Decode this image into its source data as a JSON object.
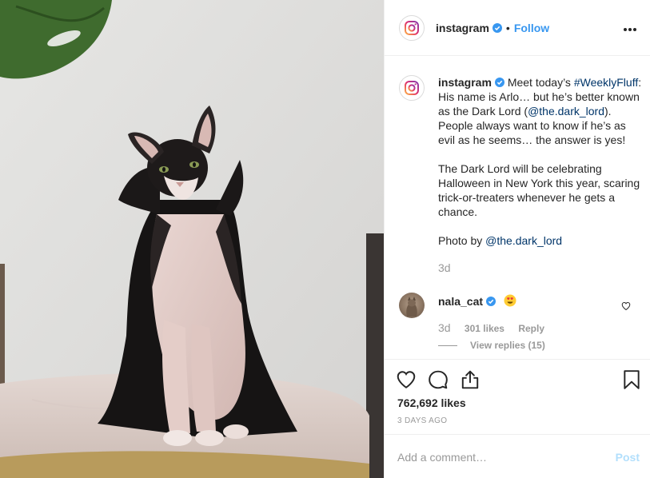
{
  "header": {
    "username": "instagram",
    "separator": "•",
    "follow_label": "Follow"
  },
  "caption": {
    "username": "instagram",
    "text_1": "Meet today’s",
    "hashtag": "#WeeklyFluff",
    "text_2": ": His name is Arlo… but he’s better known as the Dark Lord (",
    "mention_1": "@the.dark_lord",
    "text_3": "). People always want to know if he’s as evil as he seems… the answer is yes!",
    "paragraph_2": "The Dark Lord will be celebrating Halloween in New York this year, scaring trick-or-treaters whenever he gets a chance.",
    "photo_by": "Photo by",
    "mention_2": "@the.dark_lord",
    "time": "3d"
  },
  "comment": {
    "username": "nala_cat",
    "time": "3d",
    "likes": "301 likes",
    "reply_label": "Reply",
    "view_replies": "View replies (15)"
  },
  "post": {
    "likes": "762,692 likes",
    "posted": "3 DAYS AGO"
  },
  "add_comment": {
    "placeholder": "Add a comment…",
    "post_label": "Post"
  },
  "colors": {
    "link_blue": "#3897f0",
    "mention_blue": "#003569",
    "muted_gray": "#999999",
    "text": "#262626",
    "post_disabled": "#b2dffc",
    "verified_blue": "#3897f0"
  },
  "icons": [
    "instagram-logo-icon",
    "verified-icon",
    "more-options-icon",
    "heart-icon",
    "comment-icon",
    "share-icon",
    "bookmark-icon",
    "heart-eyes-emoji-icon"
  ]
}
